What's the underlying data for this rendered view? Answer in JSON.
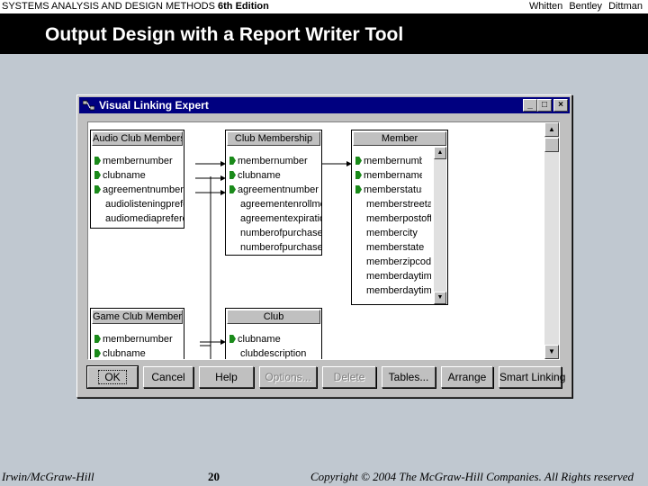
{
  "header": {
    "course": "SYSTEMS ANALYSIS AND DESIGN METHODS",
    "edition": "6th Edition",
    "authors": "Whitten  Bentley  Dittman",
    "title": "Output Design with a Report Writer Tool"
  },
  "window": {
    "caption": "Visual Linking Expert",
    "minimize": "_",
    "maximize": "□",
    "close": "×"
  },
  "tables": {
    "audio_club_membership": {
      "name": "Audio Club Membership",
      "fields": [
        "membernumber",
        "clubname",
        "agreementnumber",
        "audiolisteningpreference",
        "audiomediapreference"
      ]
    },
    "club_membership": {
      "name": "Club Membership",
      "fields": [
        "membernumber",
        "clubname",
        "agreementnumber",
        "agreementenrollmentdate",
        "agreementexpirationdate",
        "numberofpurchases",
        "numberofpurchases"
      ]
    },
    "member": {
      "name": "Member",
      "fields": [
        "membernumber",
        "membername",
        "memberstatus",
        "memberstreetaddress",
        "memberpostoffice",
        "membercity",
        "memberstate",
        "memberzipcode",
        "memberdaytimephone",
        "memberdaytimephone"
      ]
    },
    "game_club_membership": {
      "name": "Game Club Membership",
      "fields": [
        "membernumber",
        "clubname"
      ]
    },
    "club": {
      "name": "Club",
      "fields": [
        "clubname",
        "clubdescription"
      ]
    }
  },
  "buttons": {
    "ok": "OK",
    "cancel": "Cancel",
    "help": "Help",
    "options": "Options...",
    "delete": "Delete",
    "tables": "Tables...",
    "arrange": "Arrange",
    "smart_linking": "Smart Linking"
  },
  "footer": {
    "publisher": "Irwin/McGraw-Hill",
    "page": "20",
    "copyright": "Copyright © 2004 The McGraw-Hill Companies. All Rights reserved"
  },
  "colors": {
    "titlebar": "#000080",
    "key_marker": "#1a8a1a",
    "slide_bg": "#c0c8d0"
  }
}
